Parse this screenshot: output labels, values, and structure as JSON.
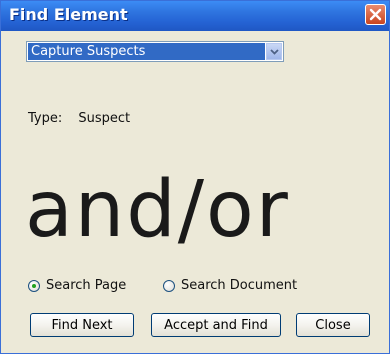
{
  "window": {
    "title": "Find Element"
  },
  "capture_select": {
    "selected": "Capture Suspects"
  },
  "type_field": {
    "label": "Type:",
    "value": "Suspect"
  },
  "suspect_preview": {
    "text": "and/or"
  },
  "search_scope": {
    "options": [
      {
        "label": "Search Page",
        "selected": true
      },
      {
        "label": "Search Document",
        "selected": false
      }
    ]
  },
  "buttons": {
    "find_next": "Find Next",
    "accept_and_find": "Accept and Find",
    "close": "Close"
  },
  "colors": {
    "title_bar": "#2563d4",
    "selection_highlight": "#316ac5",
    "radio_dot": "#21a121",
    "close_button": "#c9451f"
  },
  "icons": {
    "close": "close-x-icon",
    "dropdown": "chevron-down-icon"
  }
}
